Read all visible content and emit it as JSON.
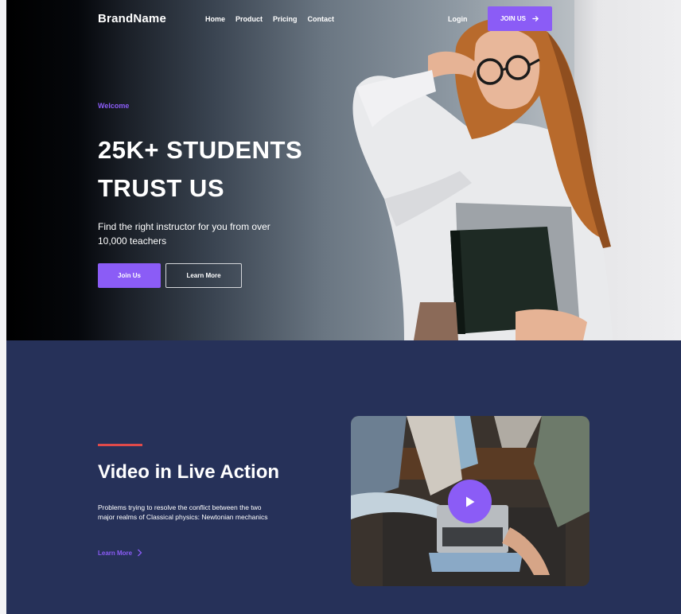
{
  "nav": {
    "brand": "BrandName",
    "links": [
      "Home",
      "Product",
      "Pricing",
      "Contact"
    ],
    "login": "Login",
    "join": "JOIN US"
  },
  "hero": {
    "eyebrow": "Welcome",
    "title_line1": "25K+ STUDENTS",
    "title_line2": "TRUST US",
    "description": "Find the right instructor for you from over 10,000 teachers",
    "primary_button": "Join Us",
    "secondary_button": "Learn More"
  },
  "video": {
    "title": "Video in Live Action",
    "description": "Problems trying to resolve the conflict between the two major realms of Classical physics: Newtonian mechanics",
    "learn_more": "Learn More"
  },
  "colors": {
    "accent": "#8b5cf6",
    "section_bg": "#263159",
    "red_bar": "#e04a4a"
  },
  "icons": [
    "arrow-right-icon",
    "chevron-right-icon",
    "play-icon"
  ]
}
